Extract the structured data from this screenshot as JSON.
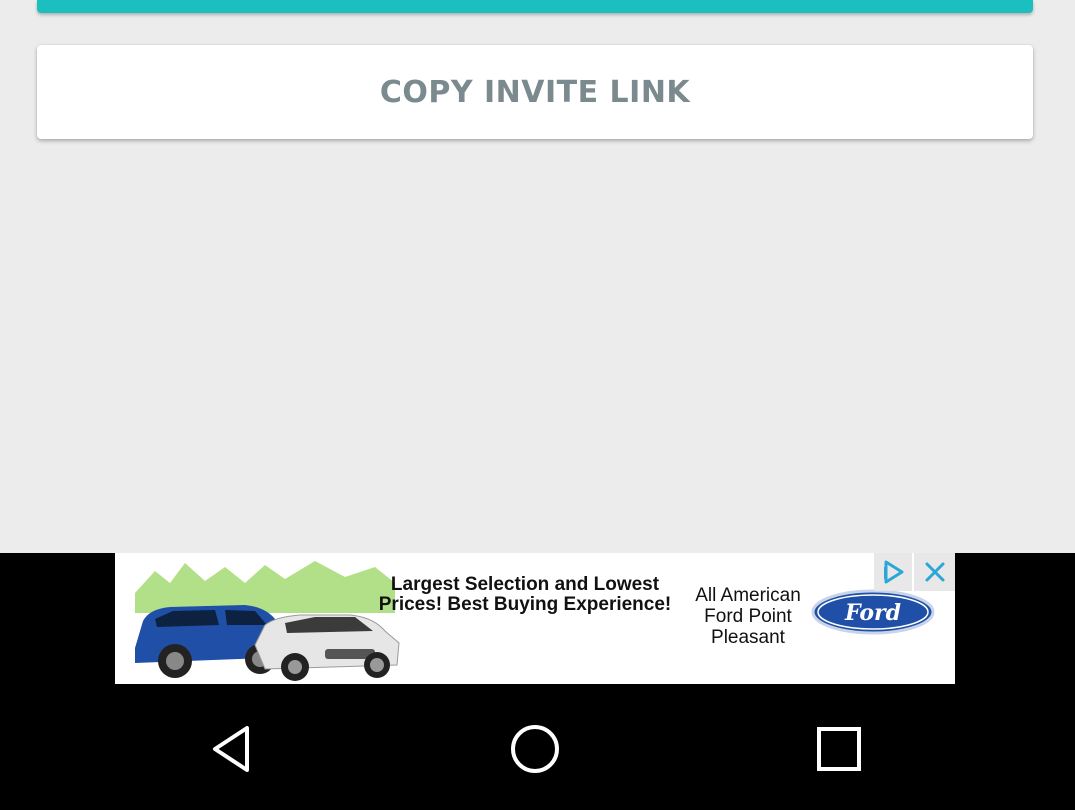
{
  "main": {
    "copy_invite_label": "COPY INVITE LINK"
  },
  "ad": {
    "headline": "Largest Selection and Lowest Prices! Best Buying Experience!",
    "dealer_name": "All American Ford Point Pleasant",
    "logo_text": "Ford",
    "icons": [
      "ad-choices-icon",
      "close-icon"
    ]
  },
  "nav": {
    "icons": [
      "back-icon",
      "home-icon",
      "recents-icon"
    ]
  },
  "colors": {
    "accent": "#1bbfbf",
    "button_text": "#7b8a8f",
    "ford_blue": "#1f4fa6"
  }
}
